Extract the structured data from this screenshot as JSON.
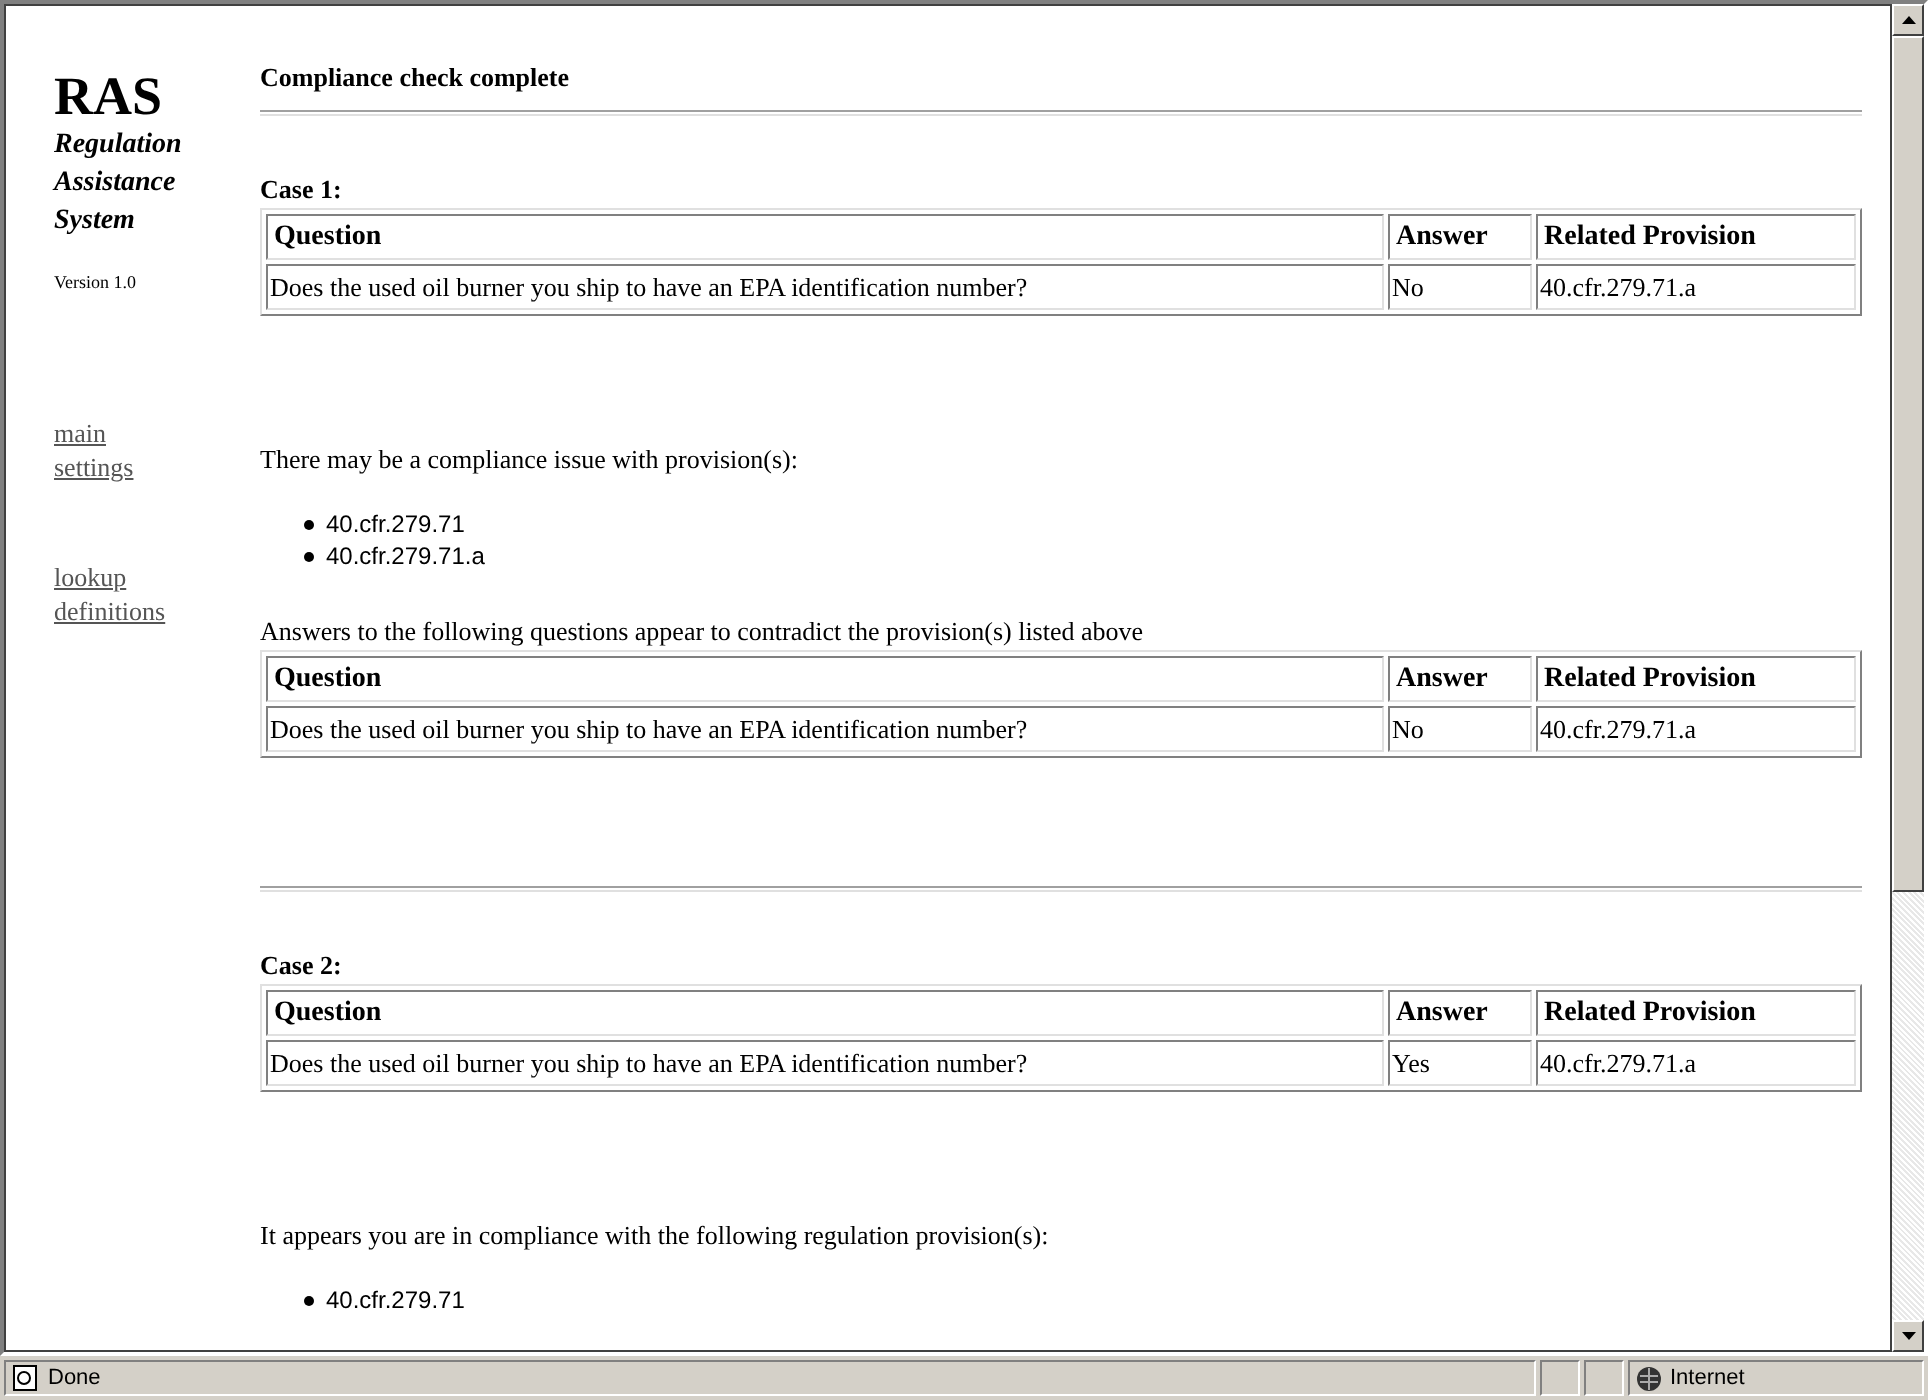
{
  "sidebar": {
    "title": "RAS",
    "subtitle": "Regulation Assistance System",
    "version": "Version 1.0",
    "links": [
      "main settings",
      "lookup definitions"
    ]
  },
  "heading": "Compliance check complete",
  "cases": [
    {
      "label": "Case 1:",
      "table": {
        "columns": [
          "Question",
          "Answer",
          "Related Provision"
        ],
        "rows": [
          [
            "Does the used oil burner you ship to have an EPA identification number?",
            "No",
            "40.cfr.279.71.a"
          ]
        ]
      },
      "result": {
        "message": "There may be a compliance issue with provision(s):",
        "provisions": [
          "40.cfr.279.71",
          "40.cfr.279.71.a"
        ]
      },
      "contradictions": {
        "message": "Answers to the following questions appear to contradict the provision(s) listed above",
        "table": {
          "columns": [
            "Question",
            "Answer",
            "Related Provision"
          ],
          "rows": [
            [
              "Does the used oil burner you ship to have an EPA identification number?",
              "No",
              "40.cfr.279.71.a"
            ]
          ]
        }
      }
    },
    {
      "label": "Case 2:",
      "table": {
        "columns": [
          "Question",
          "Answer",
          "Related Provision"
        ],
        "rows": [
          [
            "Does the used oil burner you ship to have an EPA identification number?",
            "Yes",
            "40.cfr.279.71.a"
          ]
        ]
      },
      "result": {
        "message": "It appears you are in compliance with the following regulation provision(s):",
        "provisions": [
          "40.cfr.279.71"
        ]
      }
    }
  ],
  "status_bar": {
    "text": "Done",
    "zone": "Internet"
  }
}
